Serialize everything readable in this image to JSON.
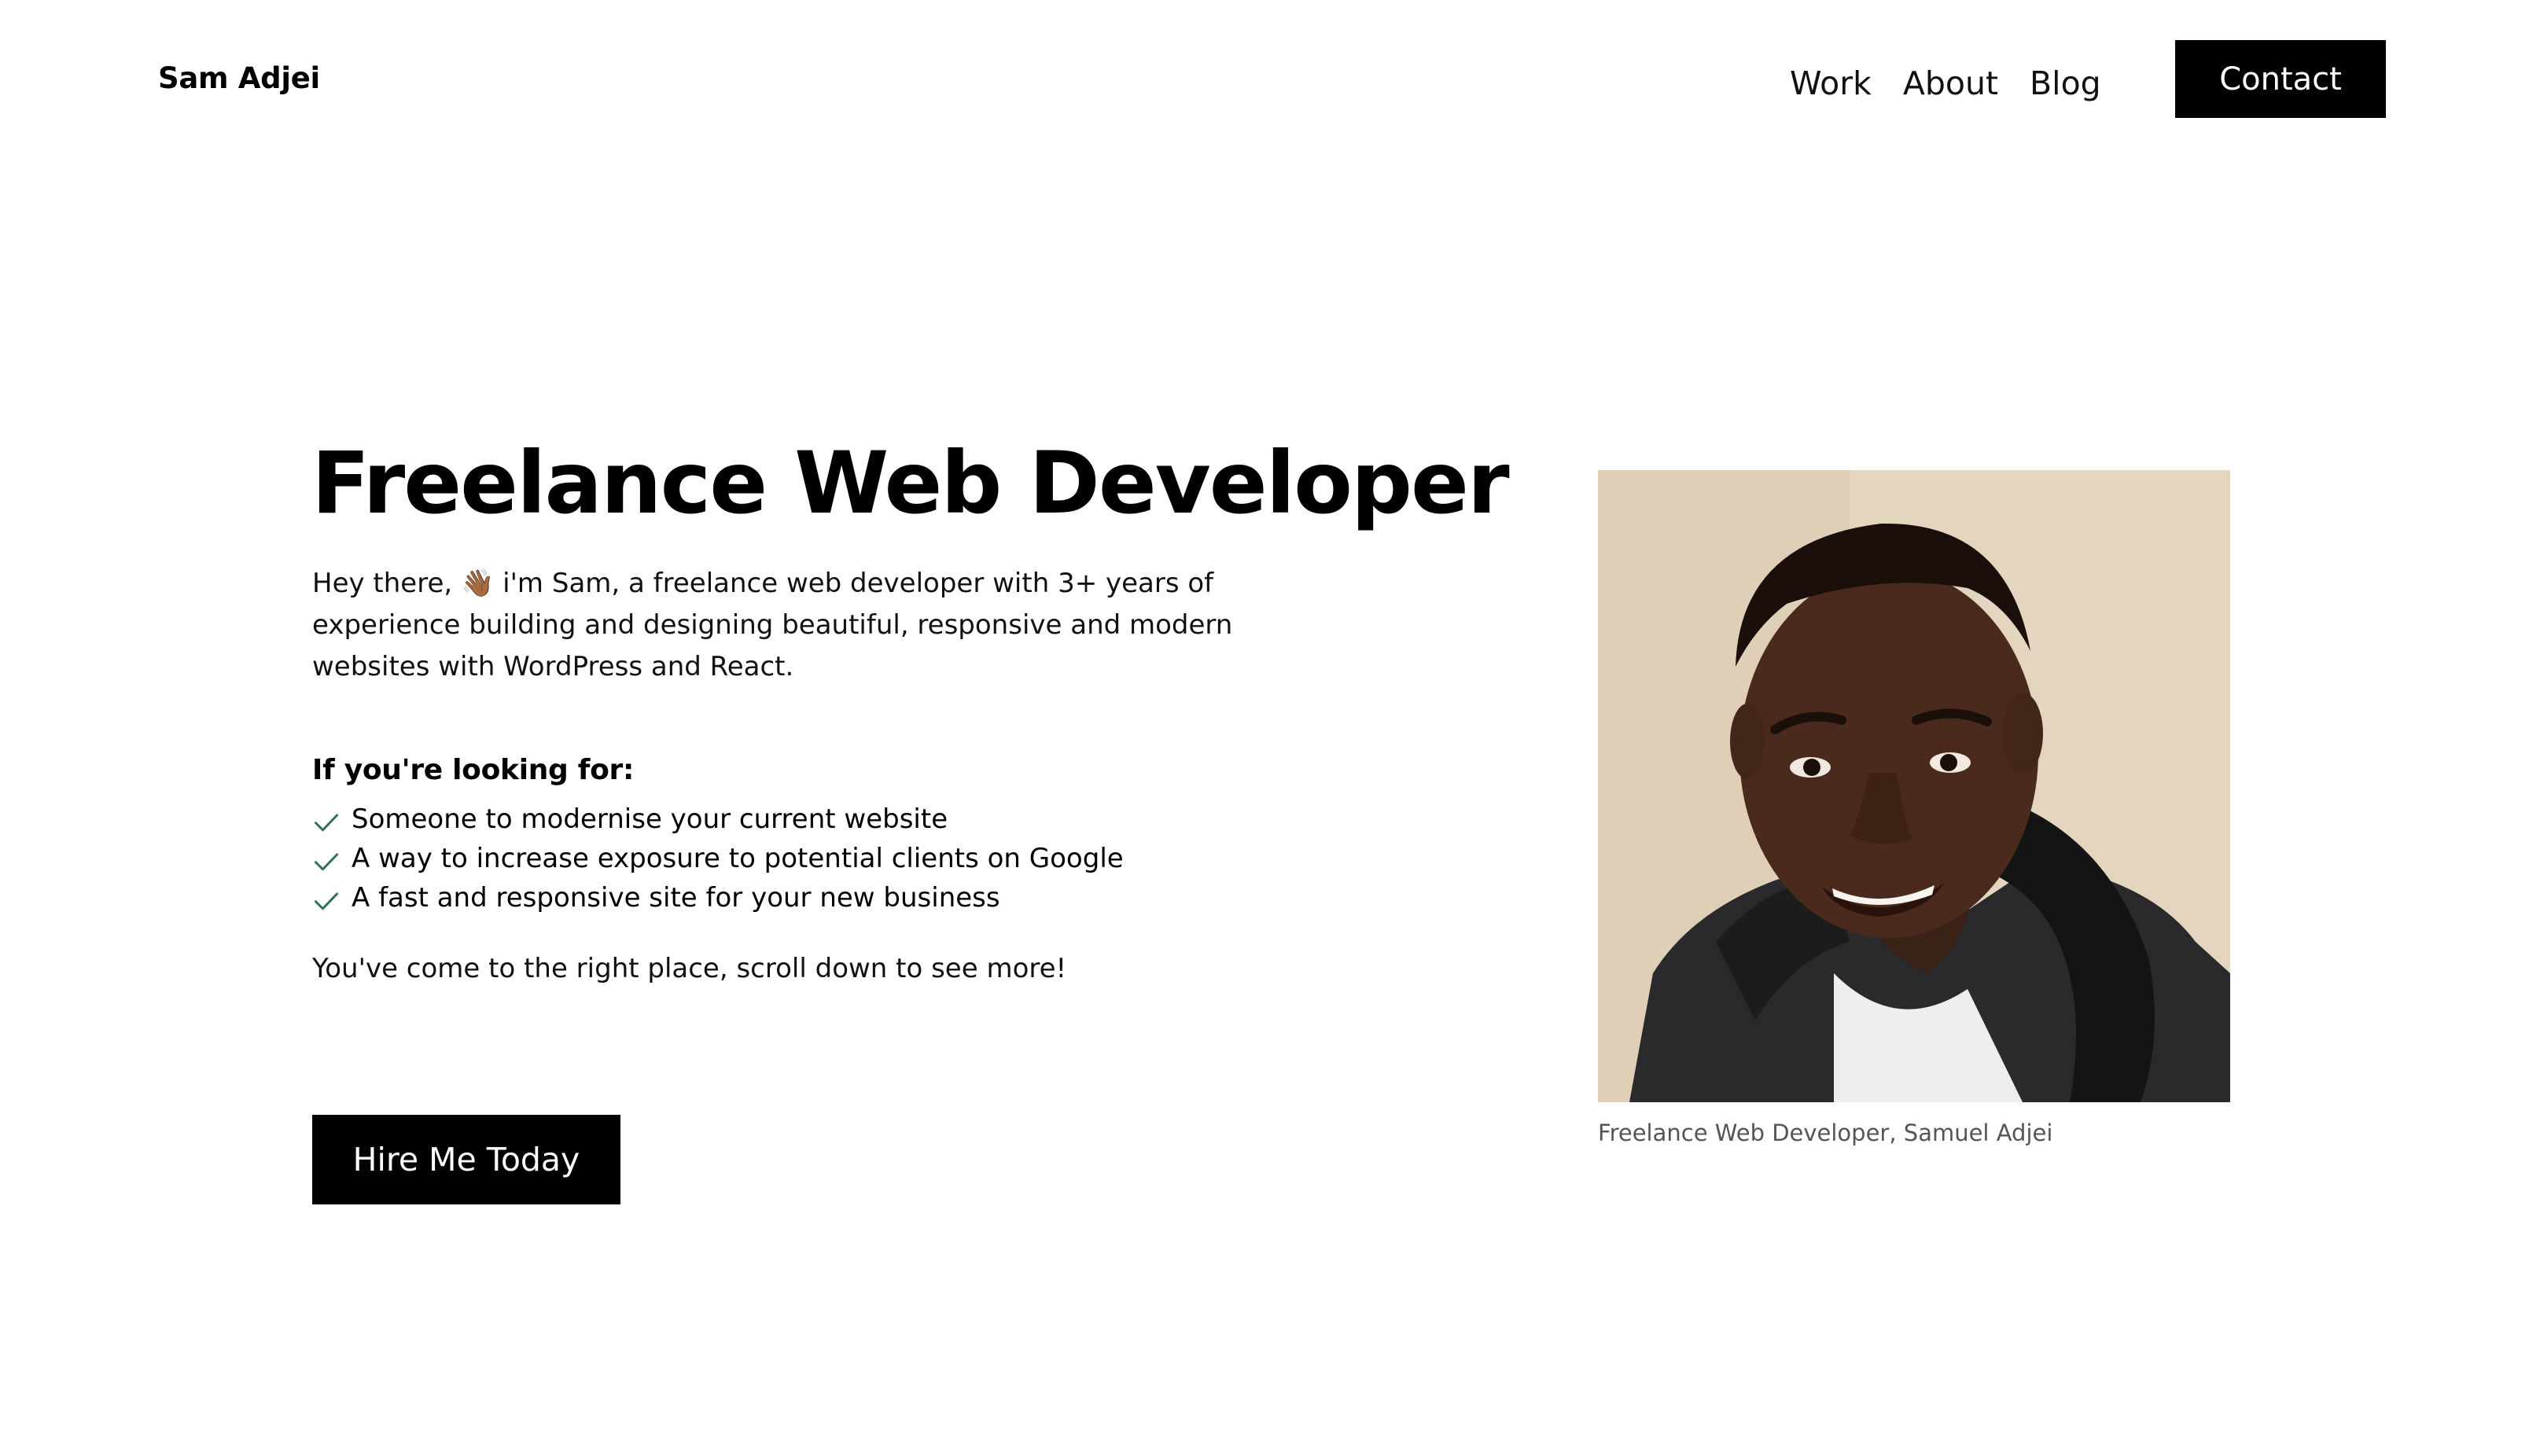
{
  "header": {
    "brand": "Sam Adjei",
    "nav": [
      {
        "label": "Work"
      },
      {
        "label": "About"
      },
      {
        "label": "Blog"
      }
    ],
    "contact_label": "Contact"
  },
  "hero": {
    "title": "Freelance Web Developer",
    "intro_before_emoji": "Hey there, ",
    "intro_emoji": "👋🏾",
    "intro_after_emoji": " i'm Sam, a freelance web developer with 3+ years of experience building and designing beautiful, responsive and modern websites with WordPress and React.",
    "looking_for_heading": "If you're looking for:",
    "checklist": [
      {
        "text": "Someone to modernise your current website",
        "icon": "check-icon"
      },
      {
        "text": "A way to increase exposure to potential clients on Google",
        "icon": "check-icon"
      },
      {
        "text": "A fast and responsive site for your new business",
        "icon": "check-icon"
      }
    ],
    "outro": "You've come to the right place, scroll down to see more!",
    "cta_label": "Hire Me Today"
  },
  "portrait": {
    "caption": "Freelance Web Developer, Samuel Adjei"
  },
  "colors": {
    "accent": "#000000",
    "check": "#2f6f5e",
    "caption": "#555555",
    "portrait_background": "#e6d8c3"
  }
}
